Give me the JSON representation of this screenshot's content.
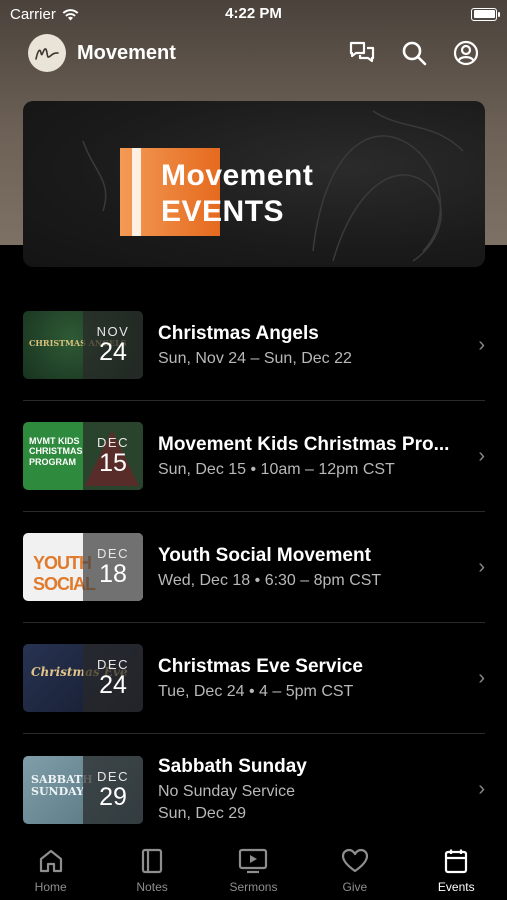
{
  "status_bar": {
    "carrier": "Carrier",
    "time": "4:22 PM"
  },
  "header": {
    "title": "Movement",
    "avatar_letter": "M",
    "icons": [
      "chat-icon",
      "search-icon",
      "profile-icon"
    ]
  },
  "hero": {
    "line1": "Movement",
    "line2": "EVENTS",
    "accent_color": "#e8772b"
  },
  "events": [
    {
      "title": "Christmas Angels",
      "line1": "Sun, Nov 24 – Sun, Dec 22",
      "line2": "",
      "month": "NOV",
      "day": "24",
      "thumb_text": "CHRISTMAS ANGELS",
      "thumb_bg": "#1f3a25"
    },
    {
      "title": "Movement Kids Christmas Pro...",
      "line1": "Sun, Dec 15 • 10am – 12pm CST",
      "line2": "",
      "month": "DEC",
      "day": "15",
      "thumb_text": "MVMT KIDS CHRISTMAS PROGRAM",
      "thumb_bg": "#2f8a3d"
    },
    {
      "title": "Youth Social Movement",
      "line1": "Wed, Dec 18 • 6:30 – 8pm CST",
      "line2": "",
      "month": "DEC",
      "day": "18",
      "thumb_text": "YOUTH SOCIAL",
      "thumb_bg": "#f2f2f2"
    },
    {
      "title": "Christmas Eve Service",
      "line1": "Tue, Dec 24 • 4 – 5pm CST",
      "line2": "",
      "month": "DEC",
      "day": "24",
      "thumb_text": "Christmas Eve",
      "thumb_bg": "#1b2236"
    },
    {
      "title": "Sabbath Sunday",
      "line1": "No Sunday Service",
      "line2": "Sun, Dec 29",
      "month": "DEC",
      "day": "29",
      "thumb_text": "SABBATH SUNDAY",
      "thumb_bg": "#6e8c98"
    }
  ],
  "tabs": [
    {
      "label": "Home",
      "icon": "home-icon",
      "active": false
    },
    {
      "label": "Notes",
      "icon": "notes-icon",
      "active": false
    },
    {
      "label": "Sermons",
      "icon": "sermons-icon",
      "active": false
    },
    {
      "label": "Give",
      "icon": "heart-icon",
      "active": false
    },
    {
      "label": "Events",
      "icon": "calendar-icon",
      "active": true
    }
  ]
}
